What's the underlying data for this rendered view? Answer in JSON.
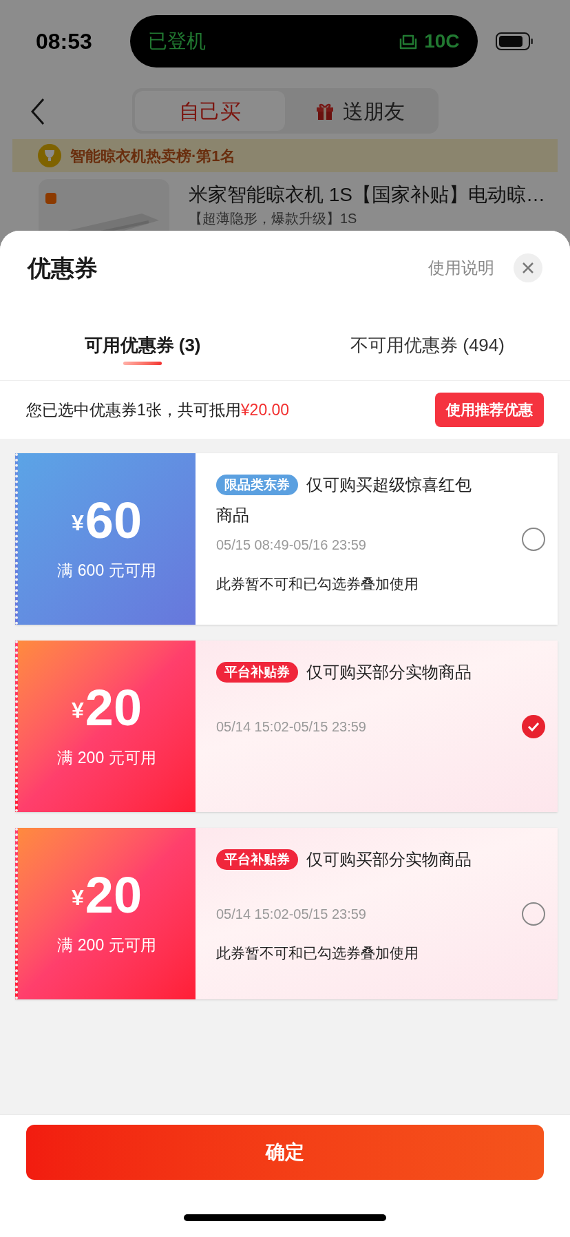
{
  "status_bar": {
    "time": "08:53",
    "island_left": "已登机",
    "island_right": "10C"
  },
  "nav": {
    "tabs": [
      {
        "label": "自己买",
        "selected": true
      },
      {
        "label": "送朋友",
        "selected": false
      }
    ]
  },
  "background": {
    "banner": "智能晾衣机热卖榜·第1名",
    "product": {
      "title": "米家智能晾衣机 1S【国家补贴】电动晾…",
      "subtitle": "【超薄隐形，爆款升级】1S"
    }
  },
  "sheet": {
    "title": "优惠券",
    "help_link": "使用说明",
    "tabs": [
      {
        "label": "可用优惠券 (3)",
        "selected": true
      },
      {
        "label": "不可用优惠券 (494)",
        "selected": false
      }
    ],
    "summary": {
      "text": "您已选中优惠券1张，共可抵用",
      "amount": "¥20.00"
    },
    "recommend_button": "使用推荐优惠",
    "coupons": [
      {
        "kind": "category",
        "currency": "¥",
        "amount": "60",
        "threshold": "满 600 元可用",
        "tag": "限品类东券",
        "description": "仅可购买超级惊喜红包商品",
        "validity": "05/15 08:49-05/16 23:59",
        "note": "此券暂不可和已勾选券叠加使用",
        "selected": false
      },
      {
        "kind": "platform",
        "currency": "¥",
        "amount": "20",
        "threshold": "满 200 元可用",
        "tag": "平台补贴券",
        "description": "仅可购买部分实物商品",
        "validity": "05/14 15:02-05/15 23:59",
        "selected": true
      },
      {
        "kind": "platform",
        "currency": "¥",
        "amount": "20",
        "threshold": "满 200 元可用",
        "tag": "平台补贴券",
        "description": "仅可购买部分实物商品",
        "validity": "05/14 15:02-05/15 23:59",
        "note": "此券暂不可和已勾选券叠加使用",
        "selected": false
      }
    ],
    "confirm_button": "确定"
  }
}
